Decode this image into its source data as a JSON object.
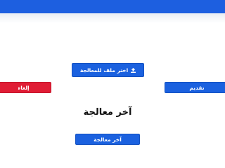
{
  "header": {
    "bar_color": "#1d5fe0"
  },
  "upload": {
    "choose_file_label": "اختر ملف للمعالجة",
    "icon": "upload-icon"
  },
  "actions": {
    "cancel_label": "إلغاء",
    "submit_label": "تقديم"
  },
  "result": {
    "heading": "آخر معالجة",
    "button_label": "آخر معالجة"
  },
  "colors": {
    "primary": "#1b61df",
    "danger": "#e01d35"
  }
}
